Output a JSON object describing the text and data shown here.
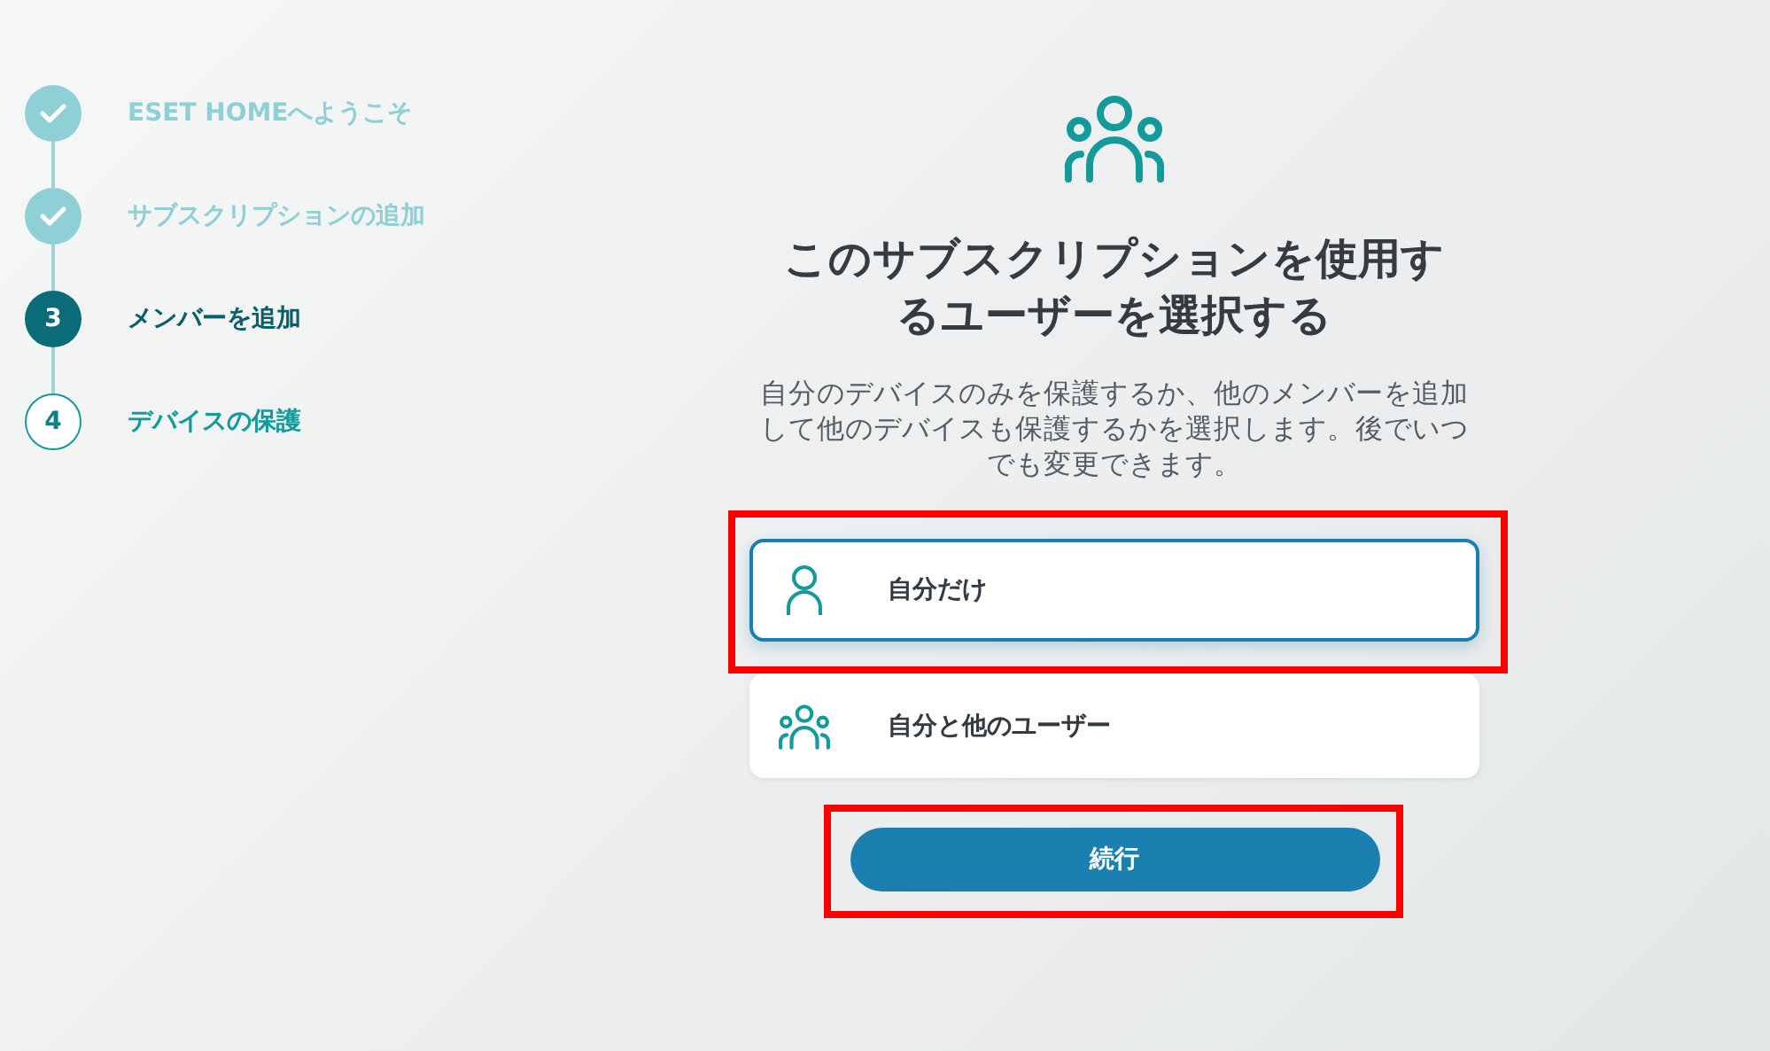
{
  "steps": [
    {
      "label": "ESET HOMEへようこそ",
      "completed": true,
      "selected": false
    },
    {
      "label": "サブスクリプションの追加",
      "completed": true,
      "selected": false
    },
    {
      "label": "メンバーを追加",
      "completed": false,
      "selected": true,
      "number": "3"
    },
    {
      "label": "デバイスの保護",
      "completed": false,
      "selected": false,
      "number": "4"
    }
  ],
  "title": "このサブスクリプションを使用するユーザーを選択する",
  "description": "自分のデバイスのみを保護するか、他のメンバーを追加して他のデバイスも保護するかを選択します。後でいつでも変更できます。",
  "options": [
    {
      "label": "自分だけ",
      "kind": "single",
      "selected": true,
      "highlighted": true
    },
    {
      "label": "自分と他のユーザー",
      "kind": "group",
      "selected": false,
      "highlighted": false
    }
  ],
  "continue_button": {
    "label": "続行",
    "highlighted": true
  }
}
